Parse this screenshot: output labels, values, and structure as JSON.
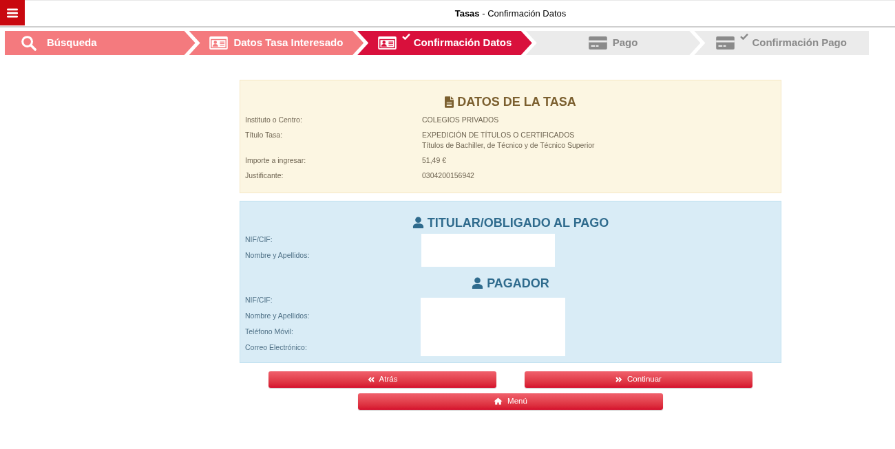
{
  "header": {
    "title": "**Tasas** - Confirmación Datos"
  },
  "steps": [
    {
      "label": "Búsqueda",
      "kind": "search",
      "selected": false,
      "completed": true,
      "checked": false
    },
    {
      "label": "Datos Tasa Interesado",
      "kind": "identity",
      "selected": false,
      "completed": true,
      "checked": false
    },
    {
      "label": "Confirmación Datos",
      "kind": "identity",
      "selected": true,
      "completed": false,
      "checked": true
    },
    {
      "label": "Pago",
      "kind": "payment",
      "selected": false,
      "completed": false,
      "checked": false
    },
    {
      "label": "Confirmación Pago",
      "kind": "payment",
      "selected": false,
      "completed": false,
      "checked": true
    }
  ],
  "fee_details": {
    "title": "DATOS DE LA TASA",
    "rows": [
      {
        "label": "Instituto o Centro:",
        "lines": [
          "COLEGIOS PRIVADOS"
        ]
      },
      {
        "label": "Título Tasa:",
        "lines": [
          "EXPEDICIÓN DE TÍTULOS O CERTIFICADOS",
          "Títulos de Bachiller, de Técnico y de Técnico Superior"
        ]
      },
      {
        "label": "Importe a ingresar:",
        "lines": [
          "51,49 €"
        ]
      },
      {
        "label": "Justificante:",
        "lines": [
          "0304200156942"
        ]
      }
    ]
  },
  "holder": {
    "title": "TITULAR/OBLIGADO AL PAGO",
    "labels": [
      "NIF/CIF:",
      "Nombre y Apellidos:"
    ]
  },
  "payer": {
    "title": "PAGADOR",
    "labels": [
      "NIF/CIF:",
      "Nombre y Apellidos:",
      "Teléfono Móvil:",
      "Correo Electrónico:"
    ]
  },
  "buttons": [
    {
      "label": "Atrás",
      "kind": "back"
    },
    {
      "label": "Continuar",
      "kind": "next"
    },
    {
      "label": "Menú",
      "kind": "home"
    }
  ]
}
